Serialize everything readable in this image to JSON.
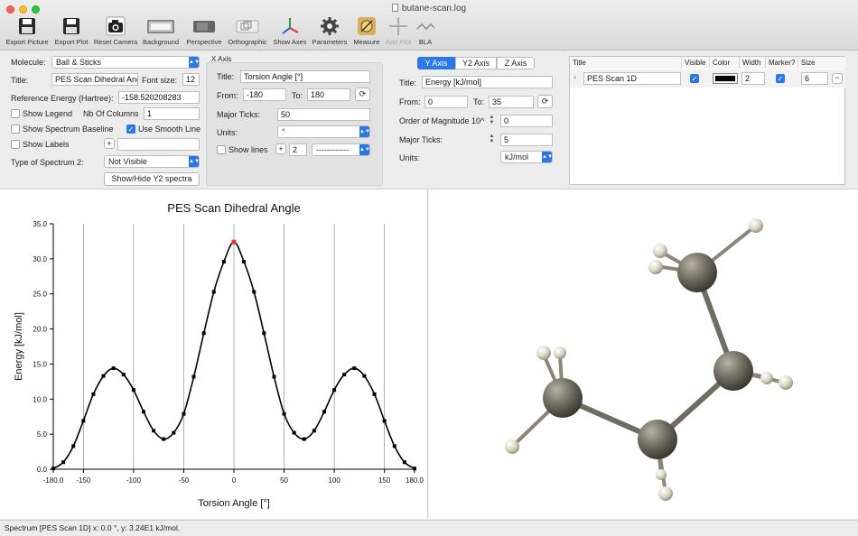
{
  "window": {
    "title": "butane-scan.log"
  },
  "toolbar": {
    "items": [
      {
        "label": "Export Picture",
        "icon": "floppy-disk-icon"
      },
      {
        "label": "Export Plot",
        "icon": "floppy-disk-icon"
      },
      {
        "label": "Reset Camera",
        "icon": "camera-icon"
      },
      {
        "label": "Background",
        "icon": "background-icon"
      },
      {
        "label": "Perspective",
        "icon": "perspective-icon"
      },
      {
        "label": "Orthographic",
        "icon": "orthographic-icon"
      },
      {
        "label": "Show Axes",
        "icon": "axes-icon"
      },
      {
        "label": "Parameters",
        "icon": "gear-icon"
      },
      {
        "label": "Measure",
        "icon": "ruler-icon"
      },
      {
        "label": "Add Plot",
        "icon": "plus-icon"
      },
      {
        "label": "BLA",
        "icon": "bla-icon"
      }
    ]
  },
  "left_panel": {
    "molecule_label": "Molecule:",
    "molecule_value": "Ball & Sticks",
    "title_label": "Title:",
    "title_value": "PES Scan Dihedral Ang",
    "font_size_label": "Font size:",
    "font_size_value": "12",
    "ref_energy_label": "Reference Energy (Hartree):",
    "ref_energy_value": "-158.520208283",
    "show_legend_label": "Show Legend",
    "show_legend_checked": false,
    "nb_columns_label": "Nb Of Columns",
    "nb_columns_value": "1",
    "show_baseline_label": "Show Spectrum Baseline",
    "show_baseline_checked": false,
    "smooth_line_label": "Use Smooth Line",
    "smooth_line_checked": true,
    "show_labels_label": "Show Labels",
    "show_labels_checked": false,
    "spectrum2_label": "Type of Spectrum 2:",
    "spectrum2_value": "Not Visible",
    "showhide_button": "Show/Hide Y2 spectra"
  },
  "x_axis": {
    "box_title": "X Axis",
    "title_label": "Title:",
    "title_value": "Torsion Angle [°]",
    "from_label": "From:",
    "from_value": "-180",
    "to_label": "To:",
    "to_value": "180",
    "major_ticks_label": "Major Ticks:",
    "major_ticks_value": "50",
    "units_label": "Units:",
    "units_value": "°",
    "show_lines_label": "Show lines",
    "lines_count": "2",
    "line_style": "------------"
  },
  "y_axis": {
    "tabs": [
      "Y Axis",
      "Y2 Axis",
      "Z Axis"
    ],
    "active_tab": 0,
    "title_label": "Title:",
    "title_value": "Energy [kJ/mol]",
    "from_label": "From:",
    "from_value": "0",
    "to_label": "To:",
    "to_value": "35",
    "order_label": "Order of Magnitude 10^",
    "order_value": "0",
    "major_ticks_label": "Major Ticks:",
    "major_ticks_value": "5",
    "units_label": "Units:",
    "units_value": "kJ/mol"
  },
  "spectra_table": {
    "headers": [
      "Title",
      "Visible",
      "Color",
      "Width",
      "Marker?",
      "Size"
    ],
    "rows": [
      {
        "title": "PES Scan 1D",
        "visible": true,
        "color": "#000000",
        "width": "2",
        "marker": true,
        "size": "6"
      }
    ]
  },
  "chart_data": {
    "type": "line",
    "title": "PES Scan Dihedral Angle",
    "xlabel": "Torsion Angle [°]",
    "ylabel": "Energy [kJ/mol]",
    "xlim": [
      -180,
      180
    ],
    "ylim": [
      0,
      35
    ],
    "x_ticks": [
      "-180.0",
      "-150",
      "-100",
      "-50",
      "0",
      "50",
      "100",
      "150",
      "180.0"
    ],
    "y_ticks": [
      "0.0",
      "5.0",
      "10.0",
      "15.0",
      "20.0",
      "25.0",
      "30.0",
      "35.0"
    ],
    "x_tick_values": [
      -180,
      -150,
      -100,
      -50,
      0,
      50,
      100,
      150,
      180
    ],
    "y_tick_values": [
      0,
      5,
      10,
      15,
      20,
      25,
      30,
      35
    ],
    "vertical_gridlines": [
      -150,
      -100,
      -50,
      0,
      50,
      100,
      150
    ],
    "series": [
      {
        "name": "PES Scan 1D",
        "color": "#000000",
        "x": [
          -180,
          -170,
          -160,
          -150,
          -140,
          -130,
          -120,
          -110,
          -100,
          -90,
          -80,
          -70,
          -60,
          -50,
          -40,
          -30,
          -20,
          -10,
          0,
          10,
          20,
          30,
          40,
          50,
          60,
          70,
          80,
          90,
          100,
          110,
          120,
          130,
          140,
          150,
          160,
          170,
          180
        ],
        "y": [
          0.1,
          1.0,
          3.3,
          6.9,
          10.7,
          13.3,
          14.4,
          13.5,
          11.3,
          8.2,
          5.5,
          4.3,
          5.2,
          7.9,
          13.2,
          19.4,
          25.3,
          29.6,
          32.4,
          29.6,
          25.3,
          19.4,
          13.2,
          7.9,
          5.2,
          4.3,
          5.5,
          8.2,
          11.3,
          13.5,
          14.4,
          13.3,
          10.7,
          6.9,
          3.3,
          1.0,
          0.1
        ]
      }
    ],
    "highlight": {
      "x": 0,
      "y": 32.4,
      "color": "#e04030"
    }
  },
  "status": {
    "text": "Spectrum [PES Scan 1D] x: 0.0 °,  y: 3.24E1 kJ/mol."
  }
}
